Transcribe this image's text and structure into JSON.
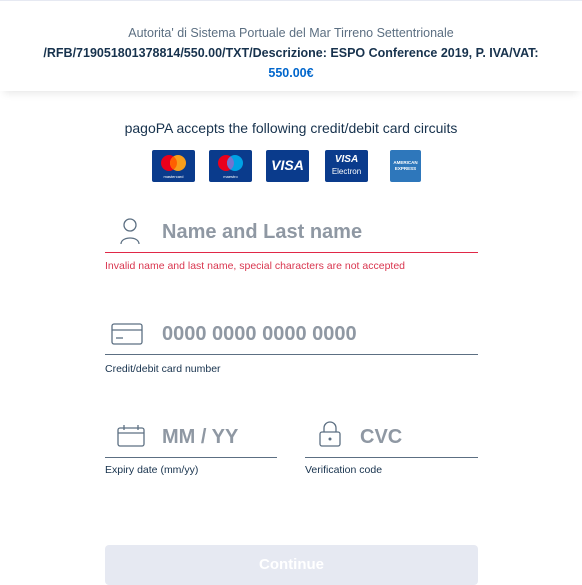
{
  "header": {
    "organization": "Autorita' di Sistema Portuale del Mar Tirreno Settentrionale",
    "description": "/RFB/719051801378814/550.00/TXT/Descrizione: ESPO Conference 2019, P. IVA/VAT:",
    "amount": "550.00€"
  },
  "circuits": {
    "title": "pagoPA accepts the following credit/debit card circuits",
    "cards": [
      {
        "name": "mastercard",
        "caption": "mastercard"
      },
      {
        "name": "maestro",
        "caption": "maestro"
      },
      {
        "name": "visa",
        "label": "VISA"
      },
      {
        "name": "visa-electron",
        "label_top": "VISA",
        "label_bottom": "Electron"
      },
      {
        "name": "american-express",
        "label_top": "AMERICAN",
        "label_bottom": "EXPRESS"
      }
    ]
  },
  "form": {
    "name": {
      "placeholder": "Name and Last name",
      "value": "",
      "error": "Invalid name and last name, special characters are not accepted",
      "icon": "user-icon"
    },
    "card_number": {
      "placeholder": "0000 0000 0000 0000",
      "value": "",
      "hint": "Credit/debit card number",
      "icon": "credit-card-icon"
    },
    "expiry": {
      "placeholder": "MM / YY",
      "value": "",
      "hint": "Expiry date (mm/yy)",
      "icon": "calendar-icon"
    },
    "cvc": {
      "placeholder": "CVC",
      "value": "",
      "hint": "Verification code",
      "icon": "lock-icon"
    }
  },
  "actions": {
    "continue_label": "Continue",
    "continue_disabled": true
  },
  "colors": {
    "primary_text": "#17324d",
    "secondary_text": "#5c6f82",
    "accent": "#0066cc",
    "error": "#d9364f",
    "disabled_button": "#e6e9f2"
  }
}
